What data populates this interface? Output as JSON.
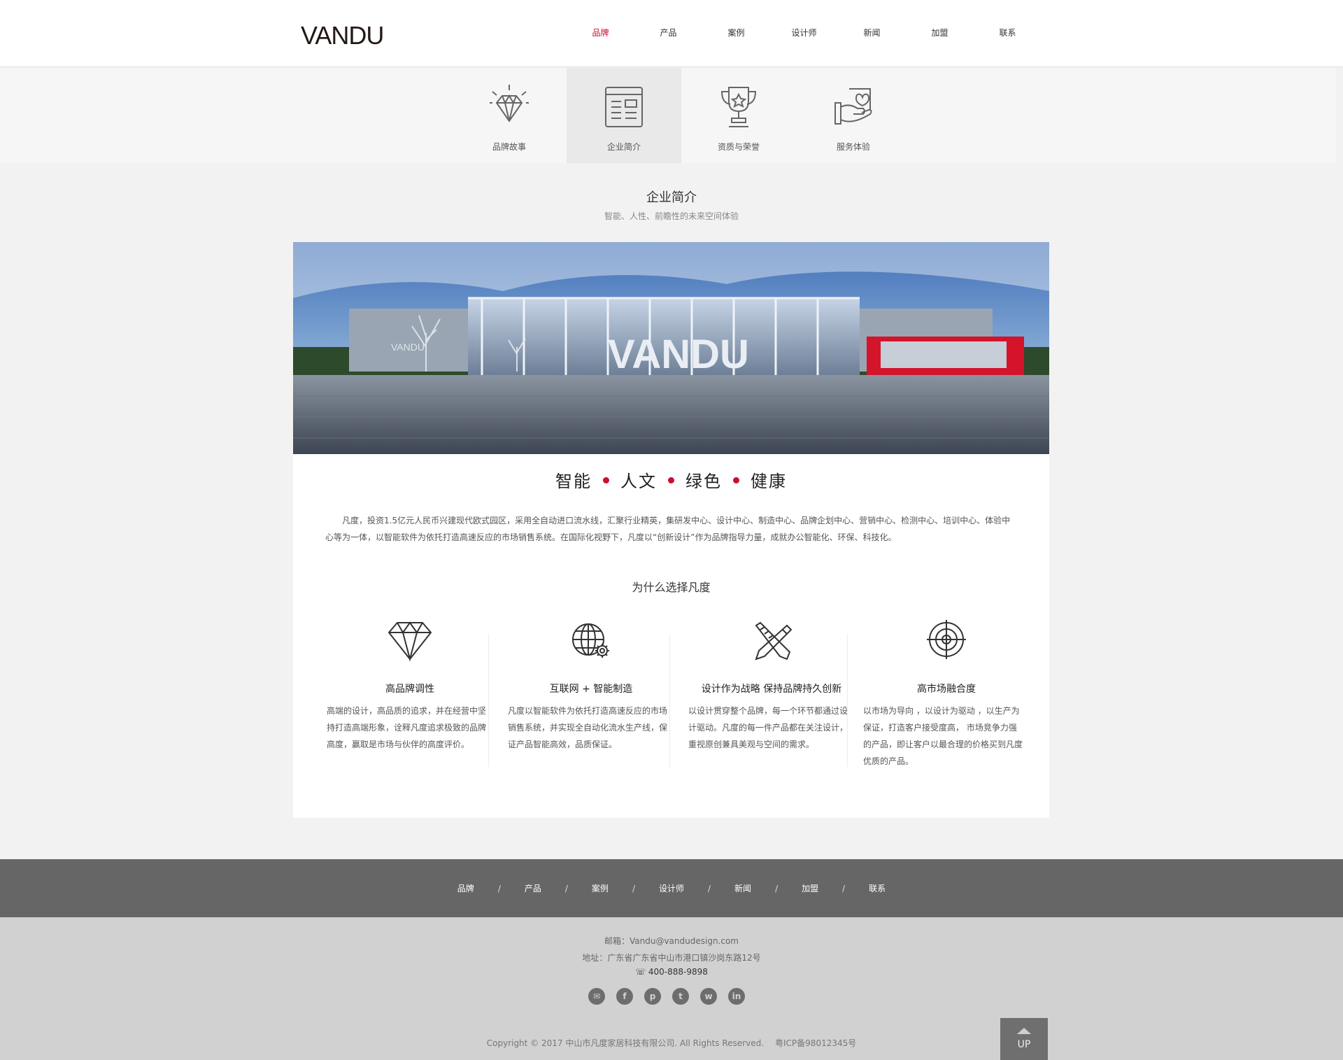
{
  "header": {
    "logo": "VANDU",
    "nav": [
      "品牌",
      "产品",
      "案例",
      "设计师",
      "新闻",
      "加盟",
      "联系"
    ],
    "active_nav": "品牌"
  },
  "subnav": {
    "items": [
      {
        "label": "品牌故事",
        "icon": "diamond-icon"
      },
      {
        "label": "企业简介",
        "icon": "document-icon"
      },
      {
        "label": "资质与荣誉",
        "icon": "trophy-icon"
      },
      {
        "label": "服务体验",
        "icon": "heart-hand-icon"
      }
    ],
    "active": "企业简介"
  },
  "section": {
    "title": "企业简介",
    "subtitle": "智能、人性、前瞻性的未来空间体验"
  },
  "hero": {
    "sign_text": "VANDU",
    "wall_text": "VANDU"
  },
  "slogan": [
    "智能",
    "人文",
    "绿色",
    "健康"
  ],
  "intro": "凡度，投资1.5亿元人民币兴建现代欧式园区，采用全自动进口流水线，汇聚行业精英，集研发中心、设计中心、制造中心、品牌企划中心、营销中心、检测中心、培训中心、体验中心等为一体，以智能软件为依托打造高速反应的市场销售系统。在国际化视野下，凡度以“创新设计”作为品牌指导力量，成就办公智能化、环保、科技化。",
  "why_title": "为什么选择凡度",
  "features": [
    {
      "icon": "diamond-icon",
      "title": "高品牌调性",
      "desc": "高端的设计，高品质的追求，并在经营中坚持打造高端形象，诠释凡度追求极致的品牌高度，赢取是市场与伙伴的高度评价。"
    },
    {
      "icon": "globe-gear-icon",
      "title": "互联网 + 智能制造",
      "desc": "凡度以智能软件为依托打造高速反应的市场销售系统，并实现全自动化流水生产线，保证产品智能高效，品质保证。"
    },
    {
      "icon": "pen-ruler-icon",
      "title": "设计作为战略 保持品牌持久创新",
      "desc": "以设计贯穿整个品牌，每一个环节都通过设计驱动。凡度的每一件产品都在关注设计，重视原创兼具美观与空间的需求。"
    },
    {
      "icon": "target-icon",
      "title": "高市场融合度",
      "desc": "以市场为导向 ，以设计为驱动 ，以生产为保证，打造客户接受度高， 市场竞争力强的产品，即让客户以最合理的价格买到凡度优质的产品。"
    }
  ],
  "footer_nav": [
    "品牌",
    "产品",
    "案例",
    "设计师",
    "新闻",
    "加盟",
    "联系"
  ],
  "footer_nav_sep": "/",
  "footer": {
    "email": "邮箱：Vandu@vandudesign.com",
    "address": "地址：广东省广东省中山市港口镇沙岗东路12号",
    "phone": "400-888-9898",
    "socials": [
      {
        "icon": "wechat-icon",
        "glyph": "✉"
      },
      {
        "icon": "facebook-icon",
        "glyph": "f"
      },
      {
        "icon": "pinterest-icon",
        "glyph": "p"
      },
      {
        "icon": "twitter-icon",
        "glyph": "t"
      },
      {
        "icon": "weibo-icon",
        "glyph": "w"
      },
      {
        "icon": "linkedin-icon",
        "glyph": "in"
      }
    ],
    "copyright": "Copyright © 2017 中山市凡度家居科技有限公司. All Rights Reserved.",
    "icp": "粤ICP备98012345号"
  },
  "up_button": "UP",
  "colors": {
    "accent": "#c8102e",
    "footer_nav_bg": "#666666",
    "footer_info_bg": "#d1d1d1",
    "page_bg": "#f2f2f2"
  }
}
